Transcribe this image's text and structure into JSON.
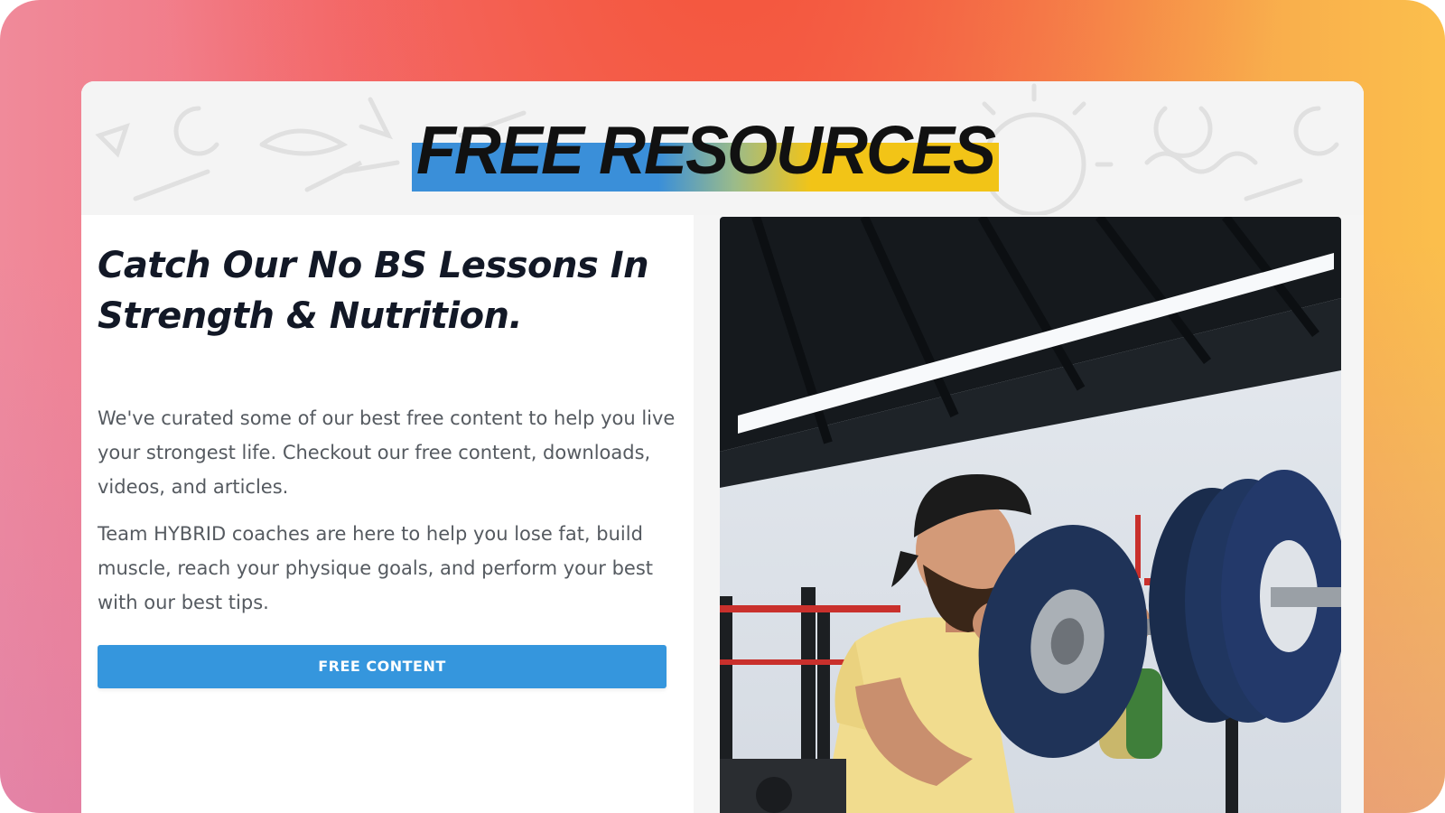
{
  "banner": {
    "title": "FREE RESOURCES"
  },
  "content": {
    "headline": "Catch Our No BS Lessons In Strength & Nutrition.",
    "paragraph1": "We've curated some of our best free content to help you live your strongest life. Checkout our free content, downloads, videos, and articles.",
    "paragraph2": "Team HYBRID coaches are here to help you lose fat, build muscle, reach your physique goals, and perform your best with our best tips.",
    "cta_label": "FREE CONTENT"
  },
  "colors": {
    "accent_blue": "#3596dd",
    "accent_yellow": "#f2c417",
    "heading": "#121826",
    "body_text": "#555a60"
  },
  "photo": {
    "subject_icon": "athlete-loading-barbell-photo"
  }
}
